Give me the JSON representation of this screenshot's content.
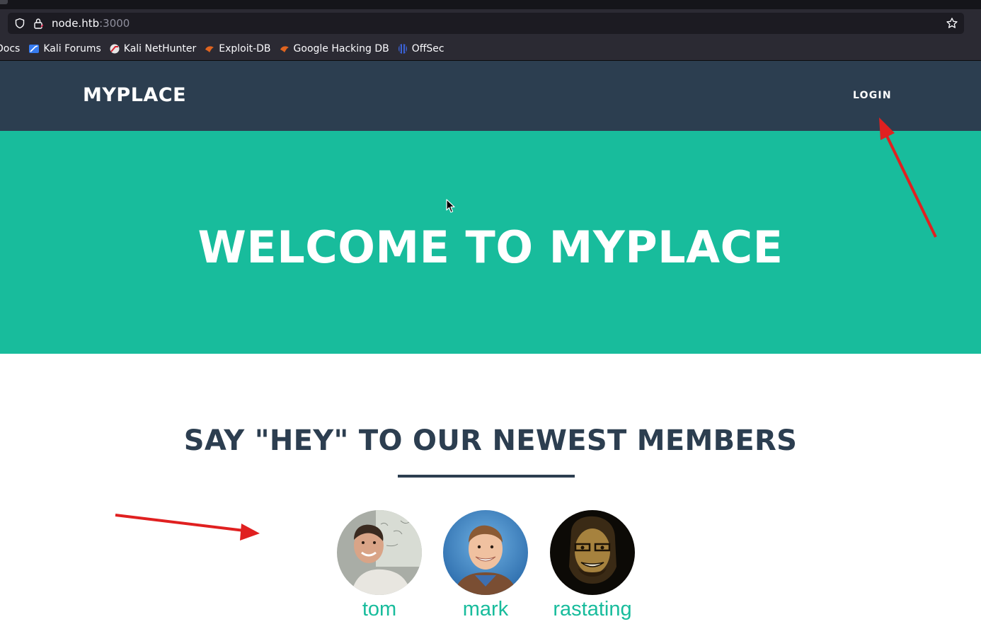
{
  "browser": {
    "url_host": "node.htb",
    "url_port": ":3000",
    "bookmarks": [
      {
        "label": "Docs",
        "icon": "docs-icon"
      },
      {
        "label": "Kali Forums",
        "icon": "kali-forums-icon"
      },
      {
        "label": "Kali NetHunter",
        "icon": "nethunter-icon"
      },
      {
        "label": "Exploit-DB",
        "icon": "exploit-db-icon"
      },
      {
        "label": "Google Hacking DB",
        "icon": "ghdb-icon"
      },
      {
        "label": "OffSec",
        "icon": "offsec-icon"
      }
    ]
  },
  "nav": {
    "brand": "MYPLACE",
    "login": "LOGIN"
  },
  "hero": {
    "title": "WELCOME TO MYPLACE"
  },
  "members": {
    "title": "SAY \"HEY\" TO OUR NEWEST MEMBERS",
    "list": [
      {
        "name": "tom"
      },
      {
        "name": "mark"
      },
      {
        "name": "rastating"
      }
    ]
  },
  "colors": {
    "nav_bg": "#2c3e50",
    "hero_bg": "#18bc9c",
    "accent": "#18bc9c",
    "annotation_arrow": "#e02020"
  }
}
